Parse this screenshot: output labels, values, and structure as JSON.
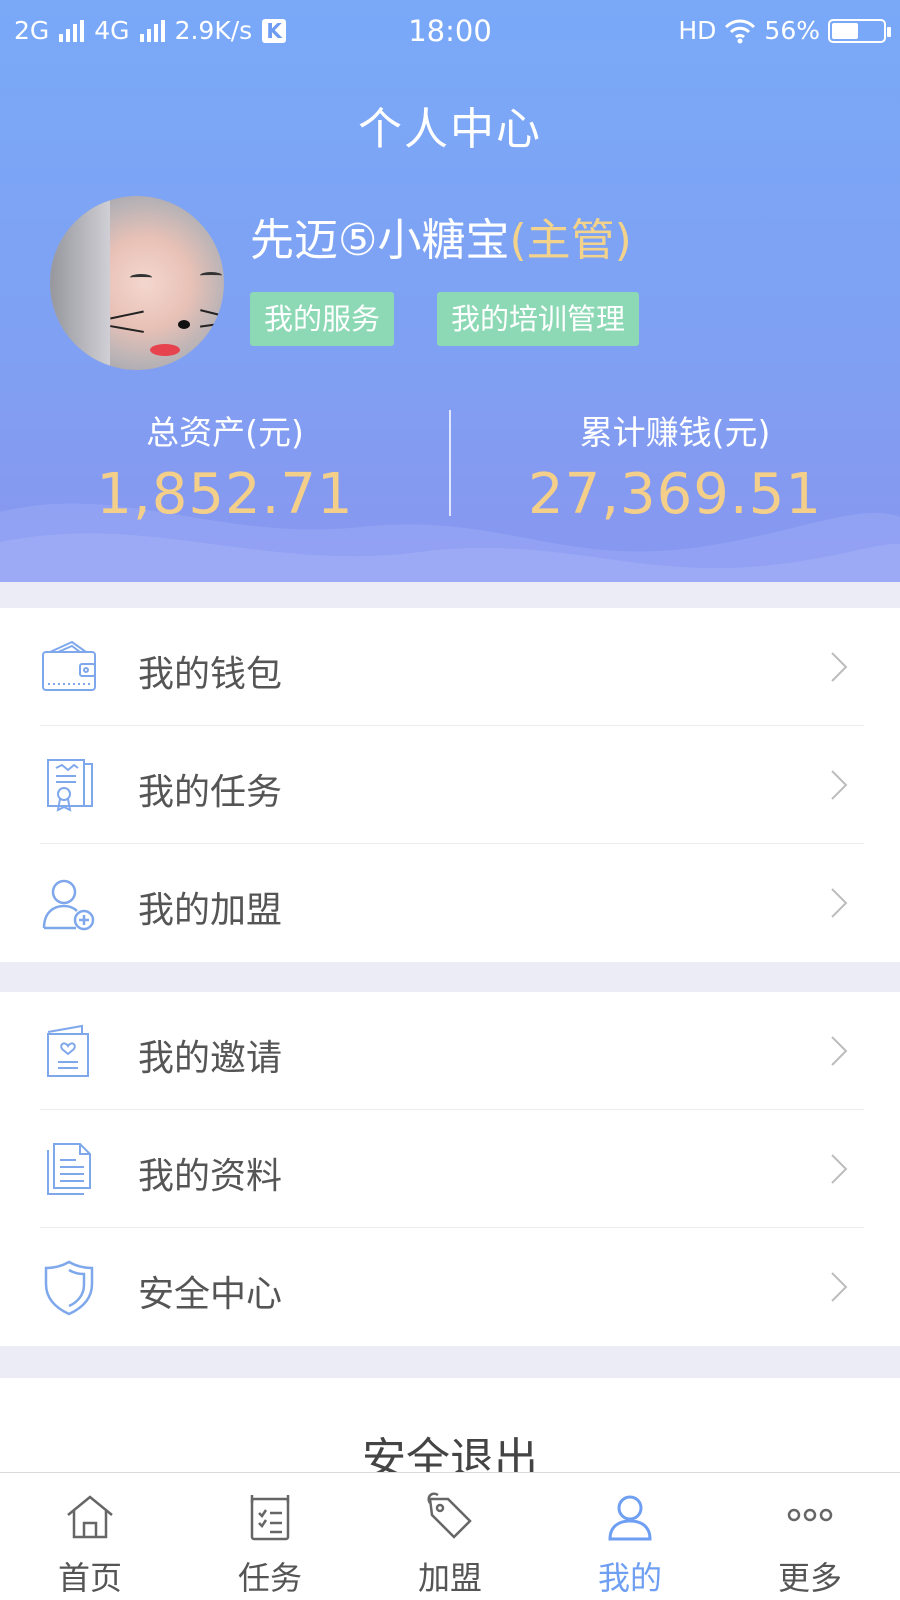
{
  "status_bar": {
    "network1": "2G",
    "network2": "4G",
    "speed": "2.9K/s",
    "app_badge": "K",
    "time": "18:00",
    "hd": "HD",
    "battery": "56%"
  },
  "header": {
    "title": "个人中心",
    "user_name": "先迈⑤小糖宝",
    "user_role": "(主管)",
    "tags": [
      "我的服务",
      "我的培训管理"
    ]
  },
  "stats": [
    {
      "label": "总资产(元)",
      "value": "1,852.71"
    },
    {
      "label": "累计赚钱(元)",
      "value": "27,369.51"
    }
  ],
  "menu_group_1": [
    {
      "label": "我的钱包",
      "icon": "wallet-icon"
    },
    {
      "label": "我的任务",
      "icon": "certificate-icon"
    },
    {
      "label": "我的加盟",
      "icon": "add-user-icon"
    }
  ],
  "menu_group_2": [
    {
      "label": "我的邀请",
      "icon": "invitation-card-icon"
    },
    {
      "label": "我的资料",
      "icon": "document-icon"
    },
    {
      "label": "安全中心",
      "icon": "shield-icon"
    }
  ],
  "logout_label": "安全退出",
  "bottom_nav": [
    {
      "label": "首页",
      "icon": "home-icon"
    },
    {
      "label": "任务",
      "icon": "task-list-icon"
    },
    {
      "label": "加盟",
      "icon": "tag-icon"
    },
    {
      "label": "我的",
      "icon": "user-icon",
      "active": true
    },
    {
      "label": "更多",
      "icon": "more-dots-icon"
    }
  ],
  "colors": {
    "header_blue": "#7aa9f8",
    "accent_gold": "#f4cf8a",
    "tag_green": "#8dd9b5",
    "icon_blue": "#6f9ff2",
    "background": "#ececf7"
  }
}
